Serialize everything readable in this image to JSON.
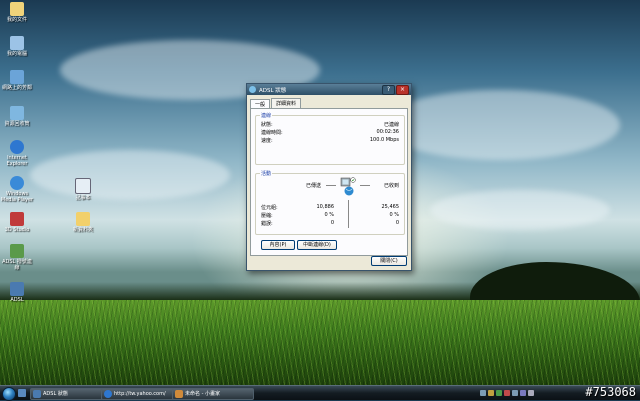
{
  "desktop": {
    "icons_left": [
      {
        "label": "我的文件",
        "color": "#f0d37a"
      },
      {
        "label": "我的電腦",
        "color": "#9cc3e6"
      },
      {
        "label": "網路上的芳鄰",
        "color": "#6ba4d8"
      },
      {
        "label": "資源回收筒",
        "color": "#7fb7e0"
      },
      {
        "label": "Internet Explorer",
        "color": "#2e77d0"
      },
      {
        "label": "Windows Media Player",
        "color": "#3a8ad8"
      },
      {
        "label": "3D Studio",
        "color": "#c03a3a"
      },
      {
        "label": "ADSL 撥號連線",
        "color": "#5a9a4a"
      },
      {
        "label": "ADSL",
        "color": "#4a7ab0"
      }
    ],
    "icons_mid": [
      {
        "label": "記事本",
        "color": "#e6eef5"
      },
      {
        "label": "新資料夾",
        "color": "#f2d06b"
      }
    ]
  },
  "window": {
    "title": "ADSL 狀態",
    "tabs": [
      "一般",
      "詳細資料"
    ],
    "connection": {
      "group_label": "連線",
      "status_label": "狀態:",
      "status_value": "已連線",
      "duration_label": "連線時間:",
      "duration_value": "00:02:36",
      "speed_label": "速度:",
      "speed_value": "100.0 Mbps"
    },
    "activity": {
      "group_label": "活動",
      "sent_label": "已傳送",
      "received_label": "已收到",
      "bytes_label": "位元組:",
      "bytes_sent": "10,886",
      "bytes_received": "25,465",
      "compression_label": "壓縮:",
      "compression_sent": "0 %",
      "compression_received": "0 %",
      "errors_label": "錯誤:",
      "errors_sent": "0",
      "errors_received": "0"
    },
    "buttons": {
      "properties": "內容(P)",
      "disconnect": "中斷連線(D)",
      "close": "關閉(C)"
    }
  },
  "taskbar": {
    "tasks": [
      {
        "label": "ADSL 狀態",
        "color": "#4a7ab0"
      },
      {
        "label": "http://tw.yahoo.com/",
        "color": "#2e77d0"
      },
      {
        "label": "未命名 - 小畫家",
        "color": "#d08a3a"
      }
    ]
  },
  "watermark": "#753068"
}
